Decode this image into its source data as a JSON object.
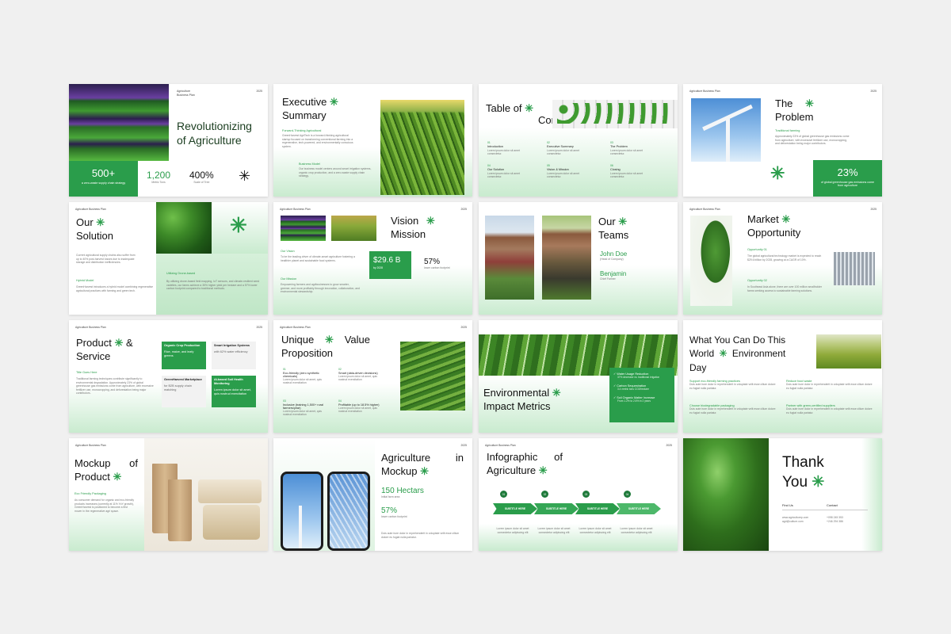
{
  "header": "Agriculture Business Plan",
  "header_lines": [
    "Agriculture",
    "Business Plan"
  ],
  "year": "2025",
  "star": "✳",
  "accent_color": "#2a9d4b",
  "s1": {
    "title": "Revolutionizing of Agriculture",
    "stat1": "500+",
    "stat1_sub": "a zero-waste supply chain strategy",
    "stat2": "1,200",
    "stat2_sub": "Metric Tons",
    "stat3": "400%",
    "stat3_sub": "Scale of Tree"
  },
  "s2": {
    "title1": "Executive",
    "title2": "Summary",
    "sub": "Forward-Thinking Agricultural",
    "body": "GreenHarvest AgriTech is a forward-thinking agricultural startup focused on transforming conventional farming into a regenerative, tech-powered, and environmentally conscious system.",
    "sub2": "Business Model",
    "body2": "Our business model centers around smart irrigation systems, organic crop production, and a zero-waste supply chain strategy."
  },
  "s3": {
    "title1": "Table of",
    "title2": "Content",
    "items": [
      {
        "num": "01",
        "label": "Introduction"
      },
      {
        "num": "02",
        "label": "Executive Summary"
      },
      {
        "num": "03",
        "label": "The Problem"
      },
      {
        "num": "04",
        "label": "Our Solution"
      },
      {
        "num": "05",
        "label": "Vision & Mission"
      },
      {
        "num": "06",
        "label": "Closing"
      }
    ],
    "item_desc": "Lorem ipsum dolor sit amet consectetur."
  },
  "s4": {
    "title1": "The",
    "title2": "Problem",
    "sub": "Traditional farming",
    "body": "Approximately 23% of global greenhouse gas emissions come from agriculture, with excessive fertilizer use, monocropping, and deforestation being major contributors.",
    "stat": "23%",
    "stat_sub": "of global greenhouse gas emissions come from agriculture"
  },
  "s5": {
    "title1": "Our",
    "title2": "Solution",
    "body": "Current agricultural supply chains also suffer from up to 40% post-harvest losses due to inadequate storage and distribution inefficiencies.",
    "sub": "Hybrid Model",
    "body2": "GreenHarvest introduces a hybrid model combining regenerative agricultural practices with farming and green tech.",
    "sub2": "Utilizing Drone-based",
    "body3": "By utilizing drone-based field mapping, IoT sensors, and climate-resilient seed varieties, our farms achieve a 35% higher yield per hectare and a 57% lower carbon footprint compared to traditional methods."
  },
  "s6": {
    "title1": "Vision",
    "title2": "Mission",
    "sub": "Our Vision",
    "body": "To be the leading driver of climate-smart agriculture fostering a healthier planet and sustainable food systems.",
    "sub2": "Our Mission",
    "body2": "Empowering farmers and agribusinesses to grow smarter, greener, and more profitably through innovation, collaboration, and environmental stewardship.",
    "stat": "$29.6 B",
    "stat_sub": "by 2028",
    "stat2": "57%",
    "stat2_sub": "lower carbon footprint"
  },
  "s7": {
    "title1": "Our",
    "title2": "Teams",
    "name1": "John Doe",
    "role1": "(Head of Company)",
    "name2": "Benjamin",
    "role2": "Chief Farmer"
  },
  "s8": {
    "title1": "Market",
    "title2": "Opportunity",
    "sub": "Opportunity 01",
    "body": "The global agricultural technology market is expected to reach $29.6 billion by 2028, growing at a CAGR of 10%.",
    "sub2": "Opportunity 02",
    "body2": "In Southeast Asia alone, there are over 100 million smallholder farms seeking access to sustainable farming solutions."
  },
  "s9": {
    "title1": "Product",
    "amp": "&",
    "title2": "Service",
    "sub": "Title Goes Here",
    "body": "Traditional farming techniques contribute significantly to environmental degradation. Approximately 23% of global greenhouse gas emissions come from agriculture, with excessive fertilizer use, monocropping, and deforestation being major contributors.",
    "boxes": [
      {
        "title": "Organic Crop Production",
        "body": "Rice, maize, and leafy greens"
      },
      {
        "title": "Smart Irrigation Systems",
        "body": "with 62% water efficiency"
      },
      {
        "title": "GreenHarvest Marketplace",
        "body": "for B2B supply chain matching"
      },
      {
        "title": "AI-based Soil Health Monitoring",
        "body": "Lorem ipsum dolor sit amet, quis nostrud exercitation"
      }
    ]
  },
  "s10": {
    "title1": "Unique",
    "title1b": "Value",
    "title2": "Proposition",
    "items": [
      {
        "num": "01",
        "label": "Eco-friendly (zero synthetic chemicals)"
      },
      {
        "num": "02",
        "label": "Smart (data-driven decisions)"
      },
      {
        "num": "03",
        "label": "Inclusive (training 1,500+ rural farmers/year)"
      },
      {
        "num": "04",
        "label": "Profitable (up to 18.5% higher)"
      }
    ],
    "item_desc": "Lorem ipsum dolor sit amet, quis nostrud exercitation"
  },
  "s11": {
    "title1": "Environmental",
    "title2": "Impact Metrics",
    "items": [
      {
        "label": "Water Usage Reduction",
        "value": "37% decrease vs. traditional irrigation"
      },
      {
        "label": "Carbon Sequestration",
        "value": "3.4 metric tons CO2/hectare"
      },
      {
        "label": "Soil Organic Matter Increase",
        "value": "From 1.2% to 2.6% in 2 years"
      }
    ]
  },
  "s12": {
    "title1": "What You Can Do This",
    "title2a": "World",
    "title2b": "Environment",
    "title3": "Day",
    "items": [
      {
        "title": "Support eco-friendly farming practices"
      },
      {
        "title": "Reduce food waste"
      },
      {
        "title": "Choose biodegradable packaging"
      },
      {
        "title": "Partner with green-certified suppliers"
      }
    ],
    "item_desc": "Duis aute irure dolor in reprehenderit in voluptate velit esse cillum dolore eu fugiat nulla pariatur."
  },
  "s13": {
    "title1": "Mockup",
    "title1b": "of",
    "title2": "Product",
    "sub": "Eco Friendly Packaging",
    "body": "As consumer demand for organic and eco-friendly products increases (currently at 11% YoY growth), GreenHarvest is positioned to become a first mover in the regenerative agri space."
  },
  "s14": {
    "title1": "Agriculture",
    "title1b": "in",
    "title2": "Mockup",
    "stat": "150 Hectars",
    "stat_sub": "Initial farm area",
    "stat2": "57%",
    "stat2_sub": "lower carbon footprint",
    "body": "Duis aute irure dolor in reprehenderit in voluptate velit esse cillum dolore eu fugiat nulla pariatur."
  },
  "s15": {
    "title1": "Infographic",
    "title1b": "of",
    "title2": "Agriculture",
    "steps": [
      {
        "num": "01",
        "label": "SUBTITLE HERE"
      },
      {
        "num": "02",
        "label": "SUBTITLE HERE"
      },
      {
        "num": "03",
        "label": "SUBTITLE HERE"
      },
      {
        "num": "04",
        "label": "SUBTITLE HERE"
      }
    ],
    "step_desc": "Lorem ipsum dolor sit amet consectetur adipiscing elit"
  },
  "s16": {
    "title1": "Thank",
    "title2": "You",
    "col1": "Find Us",
    "col2": "Contact",
    "web1": "www.agriculturep.com",
    "web2": "agri@culture.com",
    "phone1": "+098 245 353",
    "phone2": "+246 294 386"
  }
}
